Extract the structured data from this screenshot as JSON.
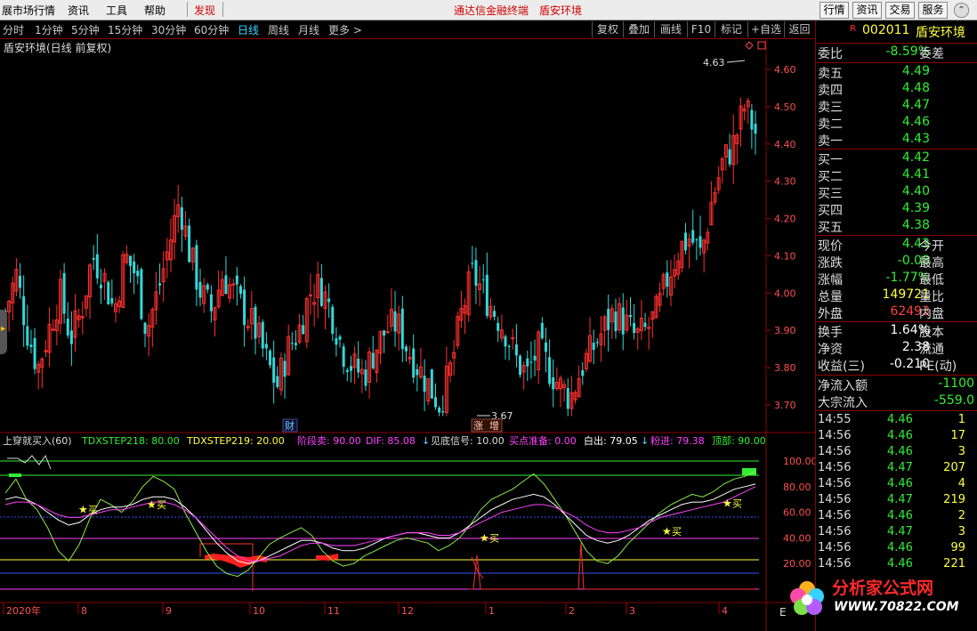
{
  "menubar": {
    "items": [
      "展市场行情",
      "资讯",
      "工具",
      "帮助",
      "发现"
    ],
    "center": [
      "通达信金融终端",
      "盾安环境"
    ],
    "right_buttons": [
      "行情",
      "资讯",
      "交易",
      "服务"
    ]
  },
  "toolbar": {
    "periods": [
      "分时",
      "1分钟",
      "5分钟",
      "15分钟",
      "30分钟",
      "60分钟",
      "日线",
      "周线",
      "月线",
      "更多 >"
    ],
    "active_period": "日线",
    "right_buttons": [
      "复权",
      "叠加",
      "画线",
      "F10",
      "标记",
      "+自选",
      "返回"
    ]
  },
  "chart_title": "盾安环境(日线 前复权)",
  "price_axis": {
    "ticks": [
      "4.60",
      "4.50",
      "4.40",
      "4.30",
      "4.20",
      "4.10",
      "4.00",
      "3.90",
      "3.80",
      "3.70"
    ],
    "range": [
      3.67,
      4.65
    ]
  },
  "annotations": {
    "high_label": "4.63",
    "low_label": "3.67",
    "event_cai": "财",
    "event_zhang": "涨",
    "event_zeng": "增"
  },
  "indicator_header": {
    "name": "上穿就买入(60)",
    "items": [
      {
        "text": "TDXSTEP218: 80.00",
        "color": "#33ee33"
      },
      {
        "text": "TDXSTEP219: 20.00",
        "color": "#ffff40"
      },
      {
        "text": "阶段卖: 90.00",
        "color": "#ff40ff"
      },
      {
        "text": "DIF: 85.08",
        "color": "#ff40ff"
      },
      {
        "text": "见底信号: 10.00",
        "color": "#dddddd"
      },
      {
        "text": "买点准备: 0.00",
        "color": "#ff40ff"
      },
      {
        "text": "白出: 79.05",
        "color": "#ffffff"
      },
      {
        "text": "粉进: 79.38",
        "color": "#ff40ff"
      },
      {
        "text": "顶部: 90.00",
        "color": "#33ee33"
      }
    ]
  },
  "indicator_axis": {
    "ticks": [
      "100.00",
      "80.00",
      "60.00",
      "40.00",
      "20.00"
    ]
  },
  "buy_label": "买",
  "x_axis": {
    "labels": [
      "2020年",
      "8",
      "9",
      "10",
      "11",
      "12",
      "1",
      "2",
      "3",
      "4"
    ],
    "end_marker": "E"
  },
  "quote": {
    "code": "002011",
    "name": "盾安环境",
    "flag": "R",
    "weibi_label": "委比",
    "weibi_value": "-8.59%",
    "weicha_label": "委差",
    "asks": [
      {
        "label": "卖五",
        "price": "4.49"
      },
      {
        "label": "卖四",
        "price": "4.48"
      },
      {
        "label": "卖三",
        "price": "4.47"
      },
      {
        "label": "卖二",
        "price": "4.46"
      },
      {
        "label": "卖一",
        "price": "4.43"
      }
    ],
    "bids": [
      {
        "label": "买一",
        "price": "4.42"
      },
      {
        "label": "买二",
        "price": "4.41"
      },
      {
        "label": "买三",
        "price": "4.40"
      },
      {
        "label": "买四",
        "price": "4.39"
      },
      {
        "label": "买五",
        "price": "4.38"
      }
    ],
    "stats1": [
      {
        "label": "现价",
        "value": "4.43",
        "color": "#33ee33",
        "label2": "今开"
      },
      {
        "label": "涨跌",
        "value": "-0.08",
        "color": "#33ee33",
        "label2": "最高"
      },
      {
        "label": "涨幅",
        "value": "-1.77%",
        "color": "#33ee33",
        "label2": "最低"
      },
      {
        "label": "总量",
        "value": "149721",
        "color": "#ffff40",
        "label2": "量比"
      },
      {
        "label": "外盘",
        "value": "62493",
        "color": "#ff4040",
        "label2": "内盘"
      }
    ],
    "stats2": [
      {
        "label": "换手",
        "value": "1.64%",
        "color": "#ffffff",
        "label2": "股本"
      },
      {
        "label": "净资",
        "value": "2.38",
        "color": "#ffffff",
        "label2": "流通"
      },
      {
        "label": "收益(三)",
        "value": "-0.210",
        "color": "#ffffff",
        "label2": "PE(动)"
      }
    ],
    "flows": [
      {
        "label": "净流入额",
        "value": "-1100"
      },
      {
        "label": "大宗流入",
        "value": "-559.0"
      }
    ],
    "ticks": [
      {
        "time": "14:55",
        "price": "4.46",
        "vol": "1"
      },
      {
        "time": "14:56",
        "price": "4.46",
        "vol": "17"
      },
      {
        "time": "14:56",
        "price": "4.46",
        "vol": "3"
      },
      {
        "time": "14:56",
        "price": "4.47",
        "vol": "207"
      },
      {
        "time": "14:56",
        "price": "4.46",
        "vol": "4"
      },
      {
        "time": "14:56",
        "price": "4.47",
        "vol": "219"
      },
      {
        "time": "14:56",
        "price": "4.46",
        "vol": "2"
      },
      {
        "time": "14:56",
        "price": "4.47",
        "vol": "3"
      },
      {
        "time": "14:56",
        "price": "4.46",
        "vol": "99"
      },
      {
        "time": "14:56",
        "price": "4.46",
        "vol": "221"
      }
    ]
  },
  "watermark": {
    "name": "分析家公式网",
    "url": "WWW.70822.COM"
  },
  "colors": {
    "up": "#ff3030",
    "down": "#33d8d8",
    "bg": "#000000",
    "grid": "#800000"
  },
  "chart_data": {
    "type": "candlestick",
    "title": "盾安环境(日线 前复权)",
    "ylim": [
      3.67,
      4.65
    ],
    "y_ticks": [
      3.7,
      3.8,
      3.9,
      4.0,
      4.1,
      4.2,
      4.3,
      4.4,
      4.5,
      4.6
    ],
    "x_months": [
      "2020年",
      "8",
      "9",
      "10",
      "11",
      "12",
      "1",
      "2",
      "3",
      "4"
    ],
    "marked_high": 4.63,
    "marked_low": 3.67,
    "close_trend": [
      3.95,
      4.05,
      3.9,
      3.8,
      3.9,
      4.0,
      3.88,
      3.95,
      4.1,
      4.05,
      3.95,
      4.1,
      4.05,
      3.9,
      4.0,
      4.12,
      4.25,
      4.1,
      4.0,
      3.95,
      4.05,
      4.0,
      3.95,
      3.9,
      3.82,
      3.75,
      3.85,
      3.9,
      4.0,
      4.02,
      3.95,
      3.85,
      3.8,
      3.78,
      3.85,
      3.9,
      3.92,
      3.85,
      3.8,
      3.75,
      3.7,
      3.8,
      3.95,
      4.05,
      4.0,
      3.95,
      3.9,
      3.82,
      3.78,
      3.85,
      3.8,
      3.75,
      3.72,
      3.8,
      3.85,
      3.9,
      3.95,
      3.92,
      3.88,
      3.9,
      3.95,
      4.05,
      4.12,
      4.15,
      4.1,
      4.25,
      4.35,
      4.4,
      4.5,
      4.43
    ]
  }
}
